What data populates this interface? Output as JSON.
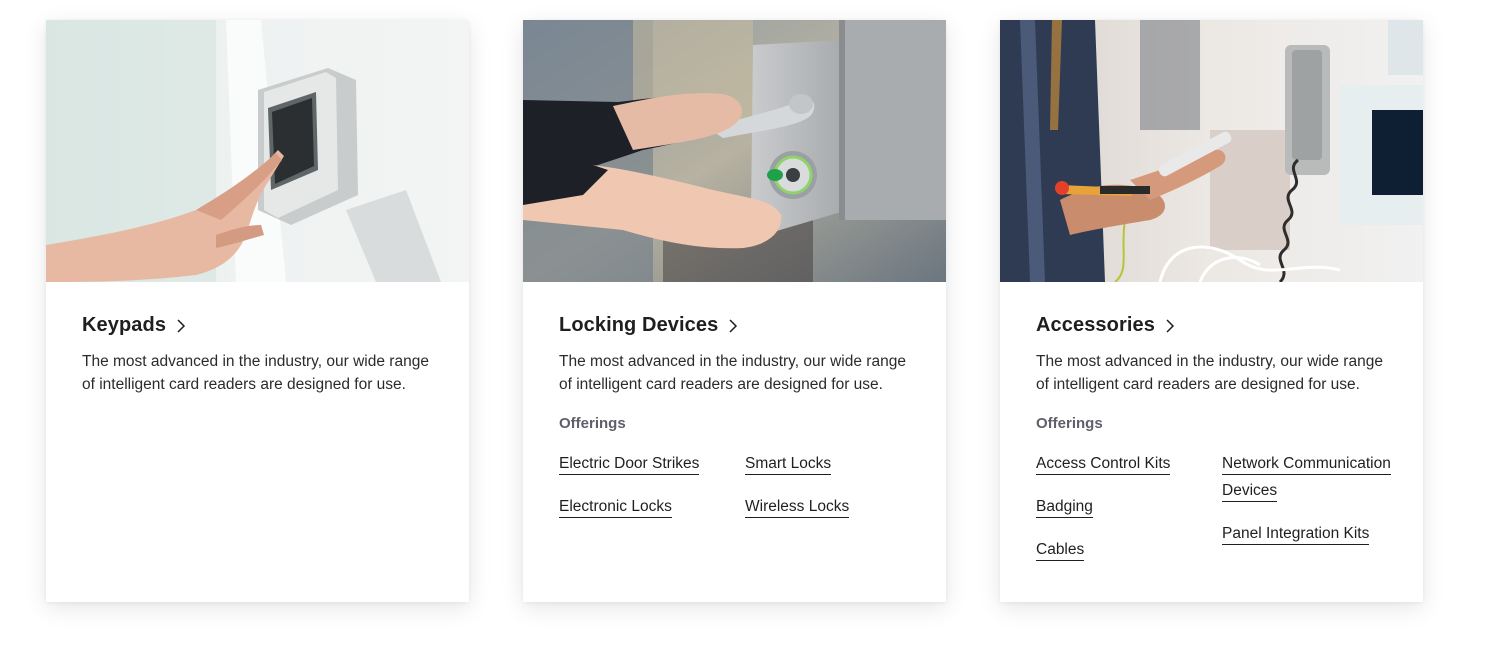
{
  "cards": [
    {
      "title": "Keypads",
      "description": "The most advanced in the industry, our wide range of intelligent card readers are designed for use.",
      "image": "keypad-hand-press-photo",
      "icon": "chevron-right-icon"
    },
    {
      "title": "Locking Devices",
      "description": "The most advanced in the industry, our wide range of intelligent card readers are designed for use.",
      "image": "door-lock-key-photo",
      "icon": "chevron-right-icon",
      "offerings_label": "Offerings",
      "offerings": [
        "Electric Door Strikes",
        "Smart Locks",
        "Electronic Locks",
        "Wireless Locks"
      ]
    },
    {
      "title": "Accessories",
      "description": "The most advanced in the industry, our wide range of intelligent card readers are designed for use.",
      "image": "technician-wiring-photo",
      "icon": "chevron-right-icon",
      "offerings_label": "Offerings",
      "offerings": [
        "Access Control Kits",
        "Network Communication Devices",
        "Badging",
        "Panel Integration Kits",
        "Cables"
      ]
    }
  ],
  "colors": {
    "text": "#1f1f1f",
    "muted": "#5f5f6a",
    "background": "#ffffff"
  }
}
